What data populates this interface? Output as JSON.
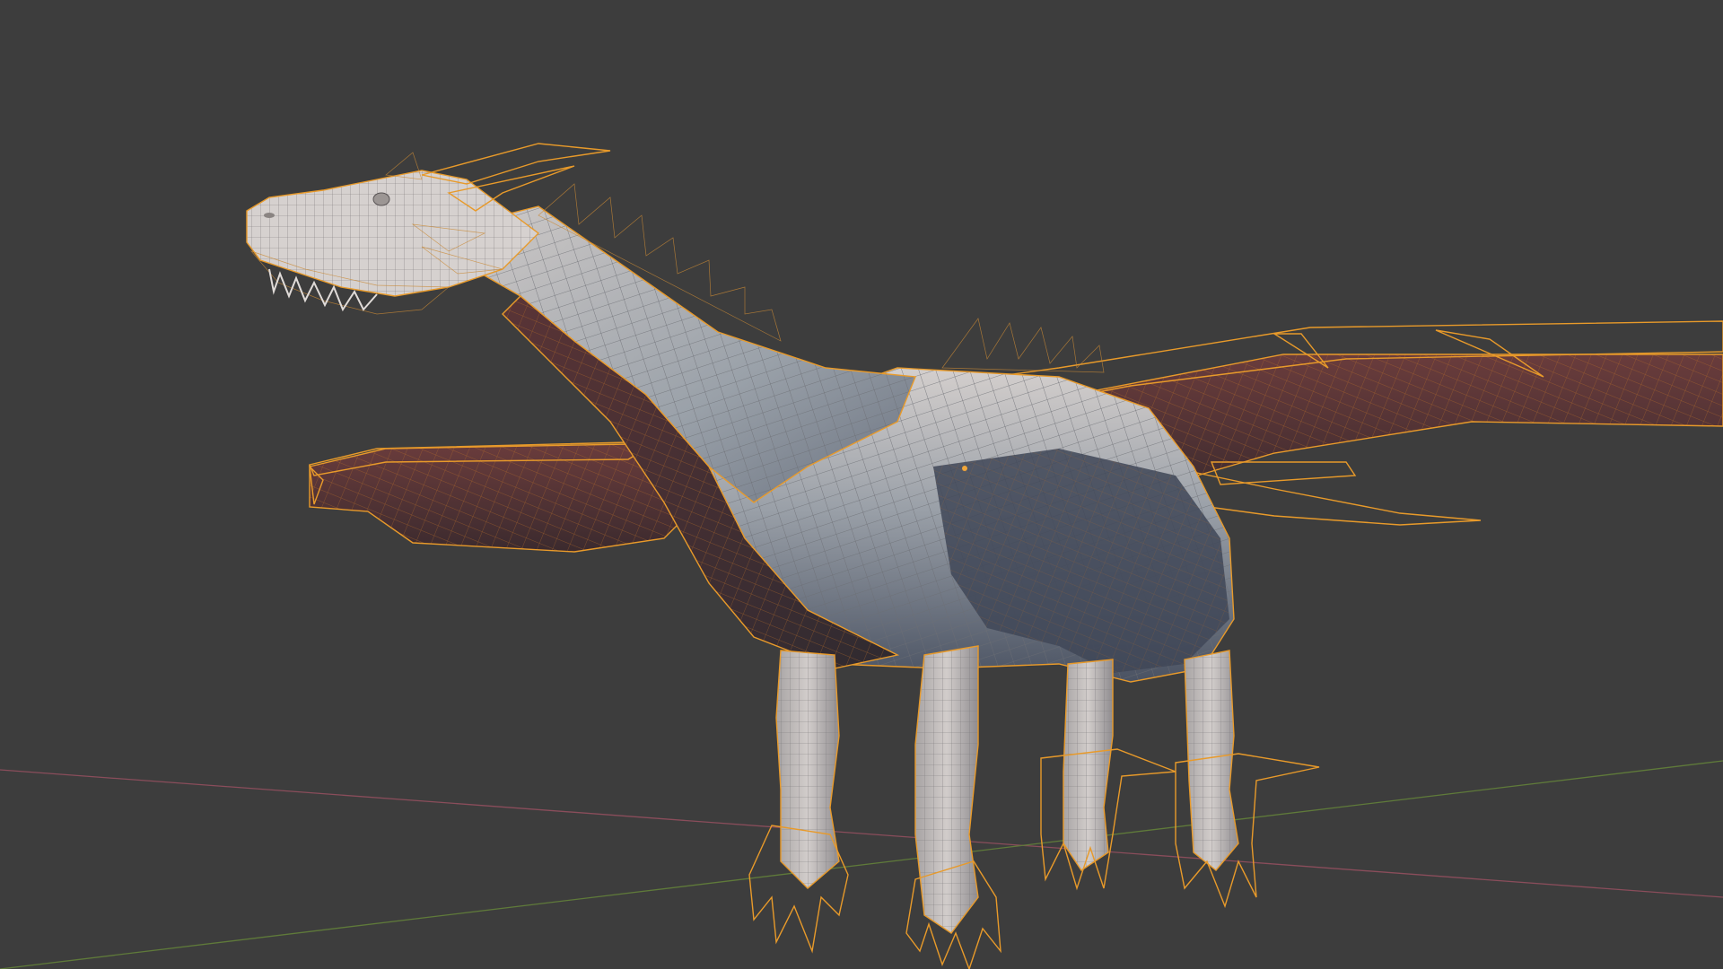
{
  "app": "3D viewport",
  "viewport": {
    "background": "#3d3d3d",
    "grid_x_axis_color": "#8a4d5b",
    "grid_y_axis_color": "#5f7a3a",
    "selection_outline_color": "#e89a2a",
    "shading_mode": "solid-with-wireframe-overlay"
  },
  "scene": {
    "selected_object": "dragon-mesh",
    "colors": {
      "surface_light": "#c9c3c1",
      "surface_mid": "#8f969d",
      "surface_shadow_blue": "#3e4656",
      "surface_shadow_maroon": "#4a2a2c",
      "membrane": "#5a3234"
    }
  }
}
